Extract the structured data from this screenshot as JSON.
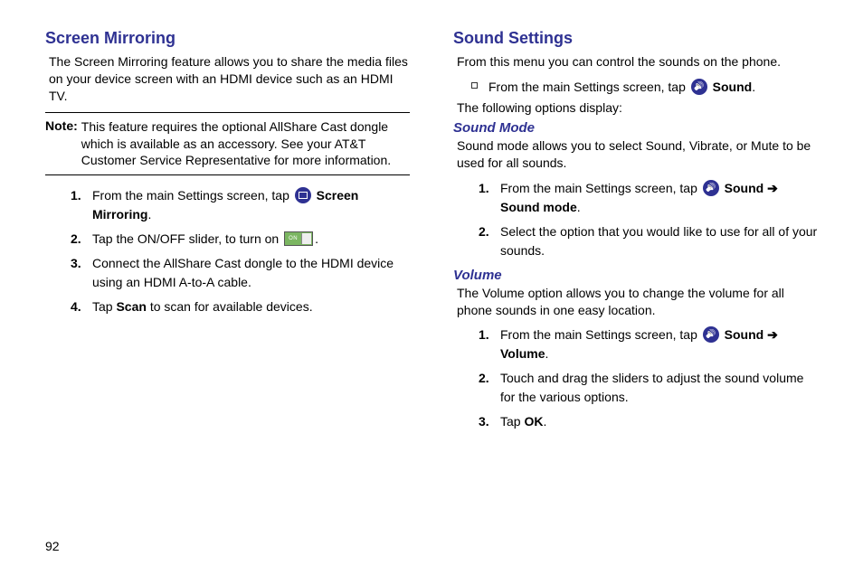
{
  "page_number": "92",
  "left": {
    "heading": "Screen Mirroring",
    "intro": "The Screen Mirroring feature allows you to share the media files on your device screen with an HDMI device such as an HDMI TV.",
    "note_label": "Note:",
    "note_text": "This feature requires the optional AllShare Cast dongle which is available as an accessory. See your AT&T Customer Service Representative for more information.",
    "step1_pre": "From the main Settings screen, tap ",
    "step1_bold": "Screen Mirroring",
    "step1_post": ".",
    "step2_pre": "Tap the ON/OFF slider, to turn on ",
    "step2_post": ".",
    "step3": "Connect the AllShare Cast dongle to the HDMI device using an HDMI A-to-A cable.",
    "step4_pre": "Tap ",
    "step4_bold": "Scan",
    "step4_post": " to scan for available devices."
  },
  "right": {
    "heading": "Sound Settings",
    "intro": "From this menu you can control the sounds on the phone.",
    "bullet_pre": "From the main Settings screen, tap ",
    "bullet_bold": "Sound",
    "bullet_post": ".",
    "following": "The following options display:",
    "soundmode": {
      "heading": "Sound Mode",
      "intro": "Sound mode allows you to select Sound, Vibrate, or Mute to be used for all sounds.",
      "step1_pre": "From the main Settings screen, tap ",
      "step1_bold1": "Sound",
      "step1_arrow": " ➔ ",
      "step1_bold2": "Sound mode",
      "step1_post": ".",
      "step2": "Select the option that you would like to use for all of your sounds."
    },
    "volume": {
      "heading": "Volume",
      "intro": "The Volume option allows you to change the volume for all phone sounds in one easy location.",
      "step1_pre": "From the main Settings screen, tap ",
      "step1_bold1": "Sound",
      "step1_arrow": " ➔ ",
      "step1_bold2": "Volume",
      "step1_post": ".",
      "step2": "Touch and drag the sliders to adjust the sound volume for the various options.",
      "step3_pre": "Tap ",
      "step3_bold": "OK",
      "step3_post": "."
    }
  }
}
